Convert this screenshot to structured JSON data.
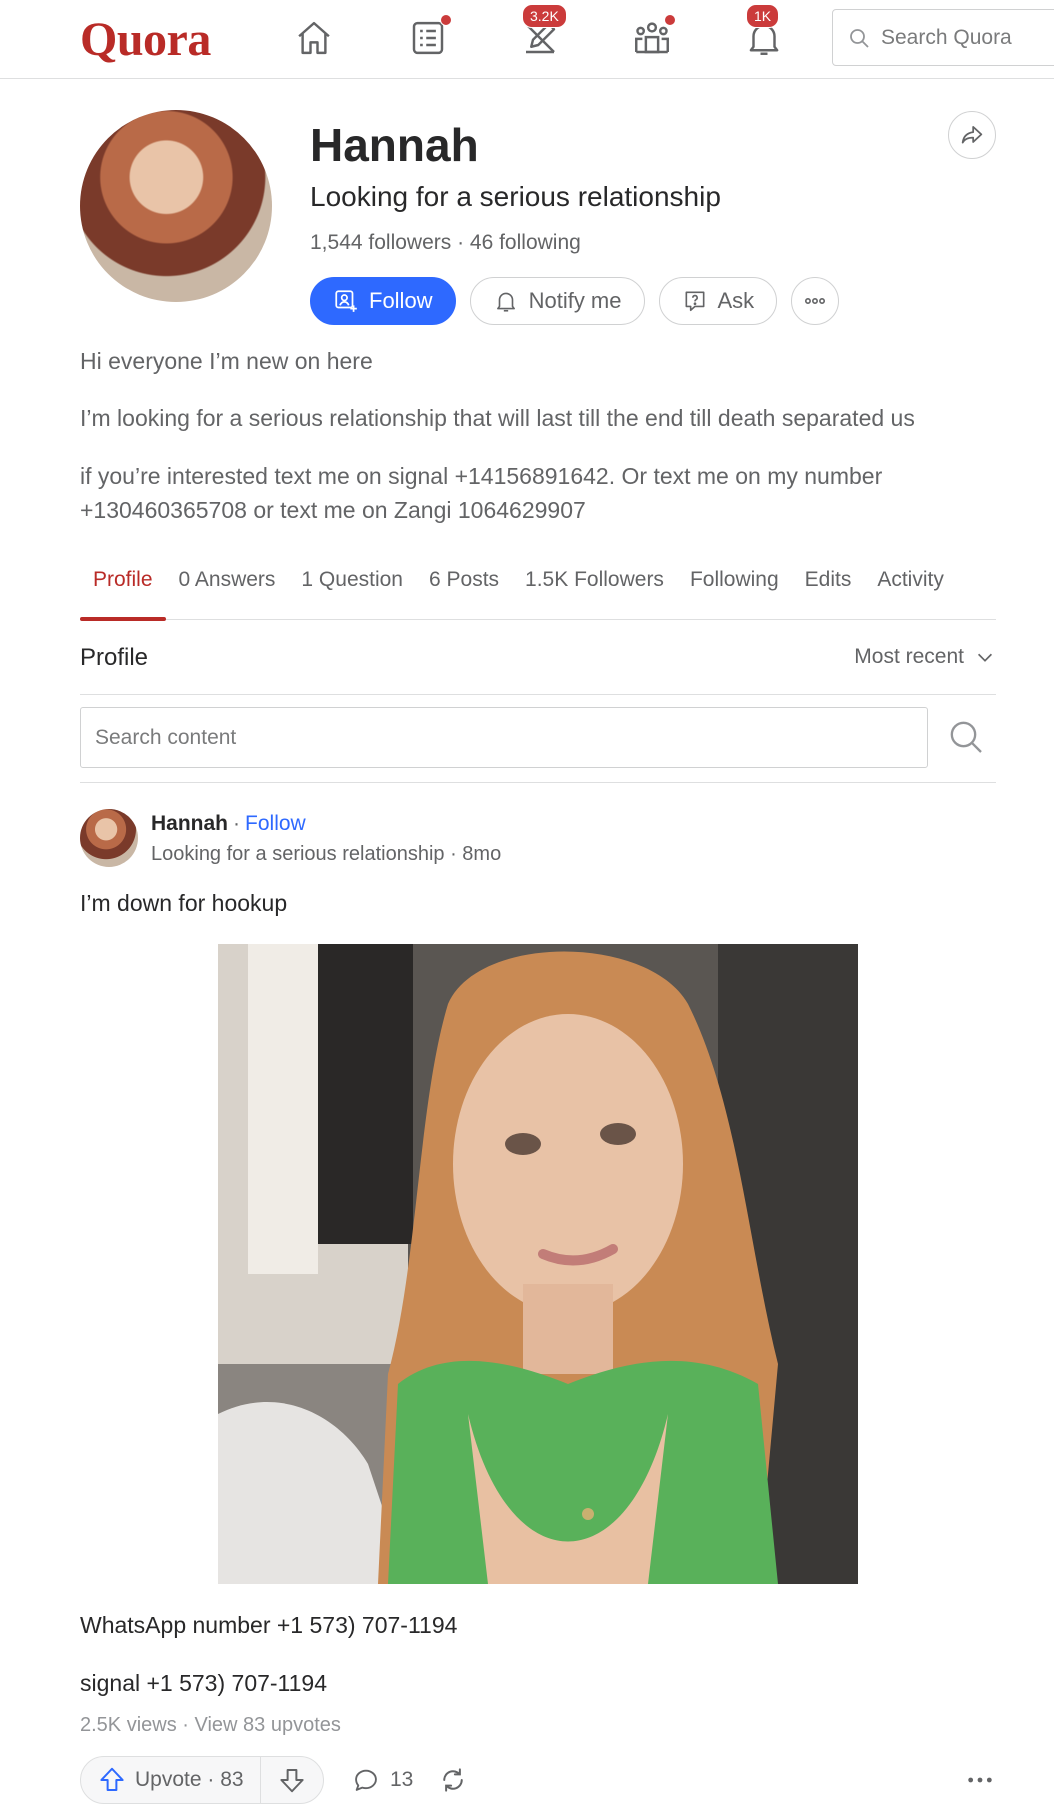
{
  "nav": {
    "logo": "Quora",
    "write_badge": "3.2K",
    "notifications_badge": "1K",
    "search_placeholder": "Search Quora"
  },
  "profile": {
    "name": "Hannah",
    "credential": "Looking for a serious relationship",
    "stats": "1,544 followers · 46 following",
    "follow_label": "Follow",
    "notify_label": "Notify me",
    "ask_label": "Ask",
    "bio": [
      "Hi everyone I’m new on here",
      "I’m looking for a serious relationship that will last till the end till death separated us",
      "if you’re interested text me on signal +14156891642. Or text me on my number +130460365708 or text me on Zangi 1064629907"
    ]
  },
  "tabs": [
    "Profile",
    "0 Answers",
    "1 Question",
    "6 Posts",
    "1.5K Followers",
    "Following",
    "Edits",
    "Activity"
  ],
  "active_tab": "Profile",
  "section": {
    "title": "Profile",
    "sort_label": "Most recent",
    "search_placeholder": "Search content"
  },
  "post": {
    "author": "Hannah",
    "separator": "·",
    "follow_label": "Follow",
    "meta": "Looking for a serious relationship · 8mo",
    "text": "I’m down for hookup",
    "line1": "WhatsApp number +1 573) 707-1194",
    "line2": "signal +1 573) 707-1194",
    "stats": "2.5K views · View 83 upvotes",
    "upvote_label": "Upvote · 83",
    "comments": "13"
  },
  "colors": {
    "brand": "#b92b27",
    "primary": "#2e69ff",
    "badge": "#cb3b3b"
  }
}
